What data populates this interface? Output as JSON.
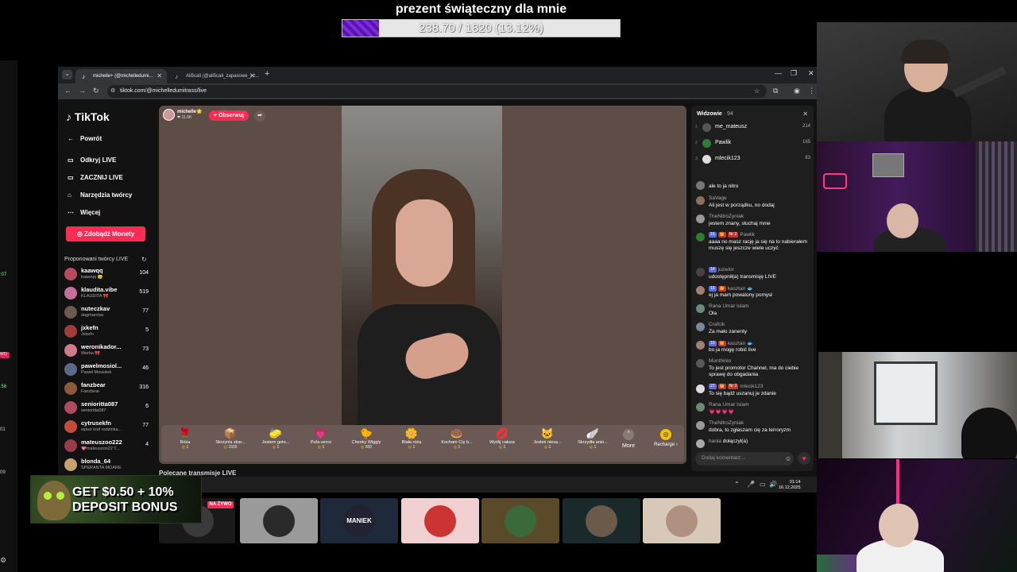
{
  "goal": {
    "title": "prezent świąteczny dla mnie",
    "text": "238.70 / 1820 (13.12%)",
    "progress": 0.1312,
    "fill_color": "#6a1fc4"
  },
  "left_strip": {
    "t1": ":07",
    "live": "WO",
    "t2": ":56",
    "t3": "01",
    "t4": "09"
  },
  "browser": {
    "tabs": [
      {
        "label": "michelle+ (@michelledumi...",
        "icon": "tiktok-icon",
        "active": true
      },
      {
        "label": "Ali5cali (@ali5cali_zapasowe_) z...",
        "icon": "tiktok-icon",
        "active": false
      }
    ],
    "url": "tiktok.com/@michelledumitrass/live"
  },
  "sidebar": {
    "logo": "TikTok",
    "back": "Powrót",
    "items": [
      {
        "label": "Odkryj LIVE",
        "icon": "tv-icon"
      },
      {
        "label": "ZACZNIJ LIVE",
        "icon": "camera-icon"
      },
      {
        "label": "Narzędzia twórcy",
        "icon": "tools-icon"
      },
      {
        "label": "Więcej",
        "icon": "more-icon"
      }
    ],
    "coins_button": "Zdobądź Monety",
    "suggested_title": "Proponowani twórcy LIVE",
    "creators": [
      {
        "name": "kaawqq",
        "sub": "kaawqq 😊",
        "count": "104",
        "color": "#b84a5a"
      },
      {
        "name": "klaudita.vibe",
        "sub": "KLAUDITA 🎀",
        "count": "519",
        "color": "#c76f9a"
      },
      {
        "name": "nuteczkav",
        "sub": "dagmarclav",
        "count": "77",
        "color": "#6d5a4a"
      },
      {
        "name": "jxkefn",
        "sub": "Jxkefn",
        "count": "5",
        "color": "#a33b3b"
      },
      {
        "name": "weronikador...",
        "sub": "Werka 🎀",
        "count": "73",
        "color": "#d07a8a"
      },
      {
        "name": "pawelmosiol...",
        "sub": "Paweł Mosiołek",
        "count": "46",
        "color": "#5a6a8a"
      },
      {
        "name": "fanzbear",
        "sub": "Fanzbear",
        "count": "316",
        "color": "#8a5a3a"
      },
      {
        "name": "senioritta087",
        "sub": "senioritta087",
        "count": "6",
        "color": "#b04a60"
      },
      {
        "name": "cytrusekfn",
        "sub": "wpisz kod rodzinka...",
        "count": "77",
        "color": "#c44a3a"
      },
      {
        "name": "mateuszoo222",
        "sub": "💖mateuszoo22 T...",
        "count": "4",
        "color": "#9a3a4a"
      },
      {
        "name": "blonda_64",
        "sub": "SPERANTA MOARE",
        "count": "",
        "color": "#c9a070"
      }
    ]
  },
  "stream": {
    "host_name": "michelle🌟",
    "host_likes": "❤ 11.6K",
    "follow": "+ Obserwuj",
    "gifts": [
      {
        "name": "Róża",
        "price": "1",
        "icon": "🌹"
      },
      {
        "name": "Skrzynia skar...",
        "price": "1500",
        "icon": "📦"
      },
      {
        "name": "Jestem goto...",
        "price": "1",
        "icon": "🧽"
      },
      {
        "name": "Pufa-serce",
        "price": "1",
        "icon": "💗"
      },
      {
        "name": "Cheeky Wiggly",
        "price": "500",
        "icon": "🐤"
      },
      {
        "name": "Biała róża",
        "price": "1",
        "icon": "🌼"
      },
      {
        "name": "Kocham Cię b...",
        "price": "1",
        "icon": "🍩"
      },
      {
        "name": "Wyślij całusa",
        "price": "1",
        "icon": "💋"
      },
      {
        "name": "Jesteś niesa...",
        "price": "1",
        "icon": "🐱"
      },
      {
        "name": "Skrzydła anio...",
        "price": "1",
        "icon": "🪽"
      }
    ],
    "more": "More",
    "recharge": "Recharge",
    "recommended_title": "Polecane transmisje LIVE"
  },
  "chat": {
    "viewers_title": "Widzowie",
    "viewers_count": "· 94",
    "top_viewers": [
      {
        "rank": "1",
        "name": "me_mateusz",
        "count": "214",
        "color": "#555"
      },
      {
        "rank": "2",
        "name": "Pawlik",
        "count": "165",
        "color": "#2e7d32"
      },
      {
        "rank": "3",
        "name": "mlecik123",
        "count": "83",
        "color": "#ddd"
      }
    ],
    "messages": [
      {
        "user": "",
        "badges": [],
        "text": "ale to ja nitro",
        "color": "#777"
      },
      {
        "user": "SaVage",
        "badges": [],
        "text": "Ali jest w porządku, no dodaj",
        "color": "#8a7060"
      },
      {
        "user": "TheNitroZyniak",
        "badges": [],
        "text": "jestem znany, słuchaj mnie",
        "color": "#999"
      },
      {
        "user": "Pawlik",
        "badges": [
          {
            "t": "16",
            "c": "#5b6ee1"
          },
          {
            "t": "👑",
            "c": "#c0392b"
          },
          {
            "t": "Nr 2",
            "c": "#c0392b"
          }
        ],
        "text": "aaaa no masz rację ja się na to nabierałem muszę się jeszcze wiele uczyć",
        "color": "#2e7d32"
      },
      {
        "user": "juzwior",
        "badges": [
          {
            "t": "14",
            "c": "#5b6ee1"
          }
        ],
        "text": "udostępnił(a) transmisję LIVE",
        "color": "#444"
      },
      {
        "user": "kasztan 🐟",
        "badges": [
          {
            "t": "10",
            "c": "#5b6ee1"
          },
          {
            "t": "👑",
            "c": "#c0392b"
          }
        ],
        "text": "ej ja mam powalony pomysł",
        "color": "#a08070"
      },
      {
        "user": "Rana Umar Islam",
        "badges": [],
        "text": "Ola",
        "color": "#6a8a7a"
      },
      {
        "user": "Crafcik",
        "badges": [],
        "text": "Za mało zanenty",
        "color": "#7a8a9a"
      },
      {
        "user": "kasztan 🐟",
        "badges": [
          {
            "t": "10",
            "c": "#5b6ee1"
          },
          {
            "t": "👑",
            "c": "#c0392b"
          }
        ],
        "text": "bo ja mogę robić live",
        "color": "#a08070"
      },
      {
        "user": "Monthinio",
        "badges": [],
        "text": "To jest promotor Channel, ma do ciebie sprawę do obgadania",
        "color": "#5a5a5a"
      },
      {
        "user": "mlecik123",
        "badges": [
          {
            "t": "27",
            "c": "#5b6ee1"
          },
          {
            "t": "👑",
            "c": "#c0392b"
          },
          {
            "t": "Nr 3",
            "c": "#c0392b"
          }
        ],
        "text": "To się bądź uszanuj je zdanie",
        "color": "#ddd"
      },
      {
        "user": "Rana Umar Islam",
        "badges": [],
        "text": "💗💗💗💗",
        "color": "#6a8a7a"
      },
      {
        "user": "TheNitroZyniak",
        "badges": [],
        "text": "dobra, to zgłaszam cię za terroryzm",
        "color": "#999"
      },
      {
        "user": "hania",
        "badges": [],
        "text": "dołączył(a)",
        "color": "#aaa",
        "join": true
      }
    ],
    "comment_placeholder": "Dodaj komentarz..."
  },
  "taskbar": {
    "time": "01:14",
    "date": "16.12.2025"
  },
  "thumbs": {
    "live_badge": "NA ŻYWO",
    "items": [
      {
        "bg": "#1a1a1a",
        "av": "#3a3a3a"
      },
      {
        "bg": "#9a9a9a",
        "av": "#2a2a2a"
      },
      {
        "bg": "#1e2a3a",
        "av": "#223",
        "label": "MANIEK"
      },
      {
        "bg": "#f0d0d0",
        "av": "#c33"
      },
      {
        "bg": "#5a4a2a",
        "av": "#3a6a3a"
      },
      {
        "bg": "#1a2a2a",
        "av": "#6a5a4a"
      },
      {
        "bg": "#d8c8b8",
        "av": "#b09080"
      }
    ]
  },
  "ad": {
    "line1": "GET $0.50 + 10%",
    "line2": "DEPOSIT BONUS"
  }
}
